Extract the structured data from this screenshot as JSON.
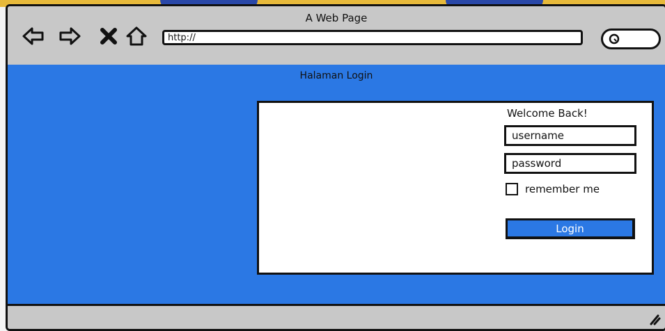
{
  "window": {
    "title": "A Web Page",
    "url": "http://",
    "nav_icons": [
      "back-arrow-icon",
      "forward-arrow-icon",
      "close-icon",
      "home-icon"
    ],
    "search_icon": "search-icon"
  },
  "content": {
    "heading": "Halaman Login",
    "background": "#2b78e4"
  },
  "login_form": {
    "welcome": "Welcome Back!",
    "username_value": "username",
    "password_value": "password",
    "remember_label": "remember me",
    "login_label": "Login"
  }
}
